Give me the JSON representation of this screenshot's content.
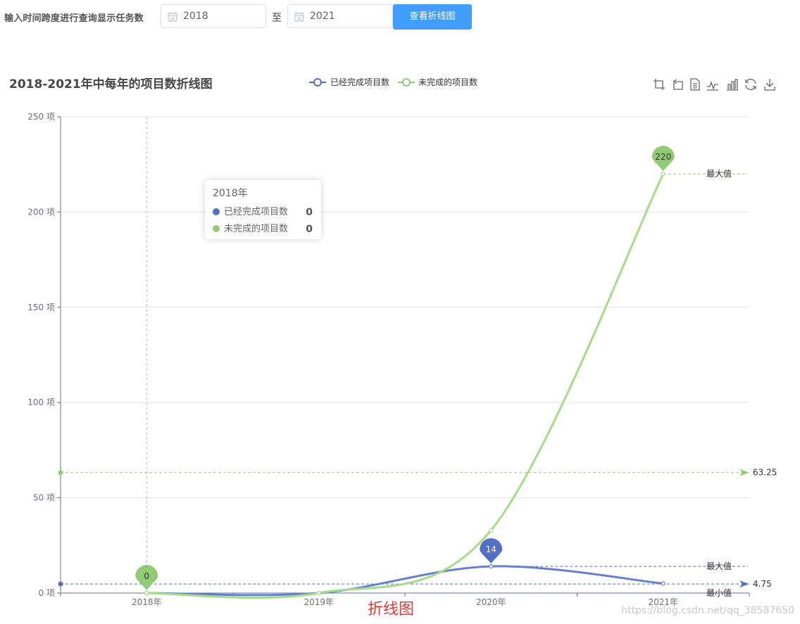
{
  "query": {
    "label": "输入时间跨度进行查询显示任务数",
    "start_value": "2018",
    "separator": "至",
    "end_value": "2021",
    "button": "查看折线图"
  },
  "tooltip": {
    "title": "2018年",
    "rows": [
      {
        "name": "已经完成项目数",
        "value": "0",
        "color": "#5470c6"
      },
      {
        "name": "未完成的项目数",
        "value": "0",
        "color": "#91cc75"
      }
    ]
  },
  "watermark": "折线图",
  "credit": "https://blog.csdn.net/qq_38587650",
  "toolbox_icons": [
    "zoom-icon",
    "zoom-reset-icon",
    "data-view-icon",
    "line-type-icon",
    "bar-type-icon",
    "restore-icon",
    "download-icon"
  ],
  "chart_data": {
    "type": "line",
    "title": "2018-2021年中每年的项目数折线图",
    "categories": [
      "2018年",
      "2019年",
      "2020年",
      "2021年"
    ],
    "ylim": [
      0,
      250
    ],
    "yticks": [
      0,
      50,
      100,
      150,
      200,
      250
    ],
    "ytick_labels": [
      "0 项",
      "50 项",
      "100 项",
      "150 项",
      "200 项",
      "250 项"
    ],
    "grid": true,
    "smooth": true,
    "legend_position": "top-center",
    "series": [
      {
        "name": "已经完成项目数",
        "color": "#5470c6",
        "line_color": "#6580d0",
        "values": [
          0,
          0,
          14,
          5
        ],
        "max_point": {
          "category": "2020年",
          "value": 14,
          "label": "14"
        },
        "min_point": {
          "category": "2018年",
          "value": 0,
          "label": "0"
        },
        "max_line": {
          "value": 14,
          "label": "最大值"
        },
        "min_line": {
          "value": 0,
          "label": "最小值"
        },
        "average_line": {
          "value": 4.75,
          "label": "4.75"
        }
      },
      {
        "name": "未完成的项目数",
        "color": "#91cc75",
        "line_color": "#a4dc88",
        "values": [
          0,
          0,
          33,
          220
        ],
        "max_point": {
          "category": "2021年",
          "value": 220,
          "label": "220"
        },
        "min_point": {
          "category": "2018年",
          "value": 0,
          "label": "0"
        },
        "max_line": {
          "value": 220,
          "label": "最大值"
        },
        "average_line": {
          "value": 63.25,
          "label": "63.25"
        }
      }
    ],
    "axis_pointer": {
      "category": "2018年"
    }
  }
}
